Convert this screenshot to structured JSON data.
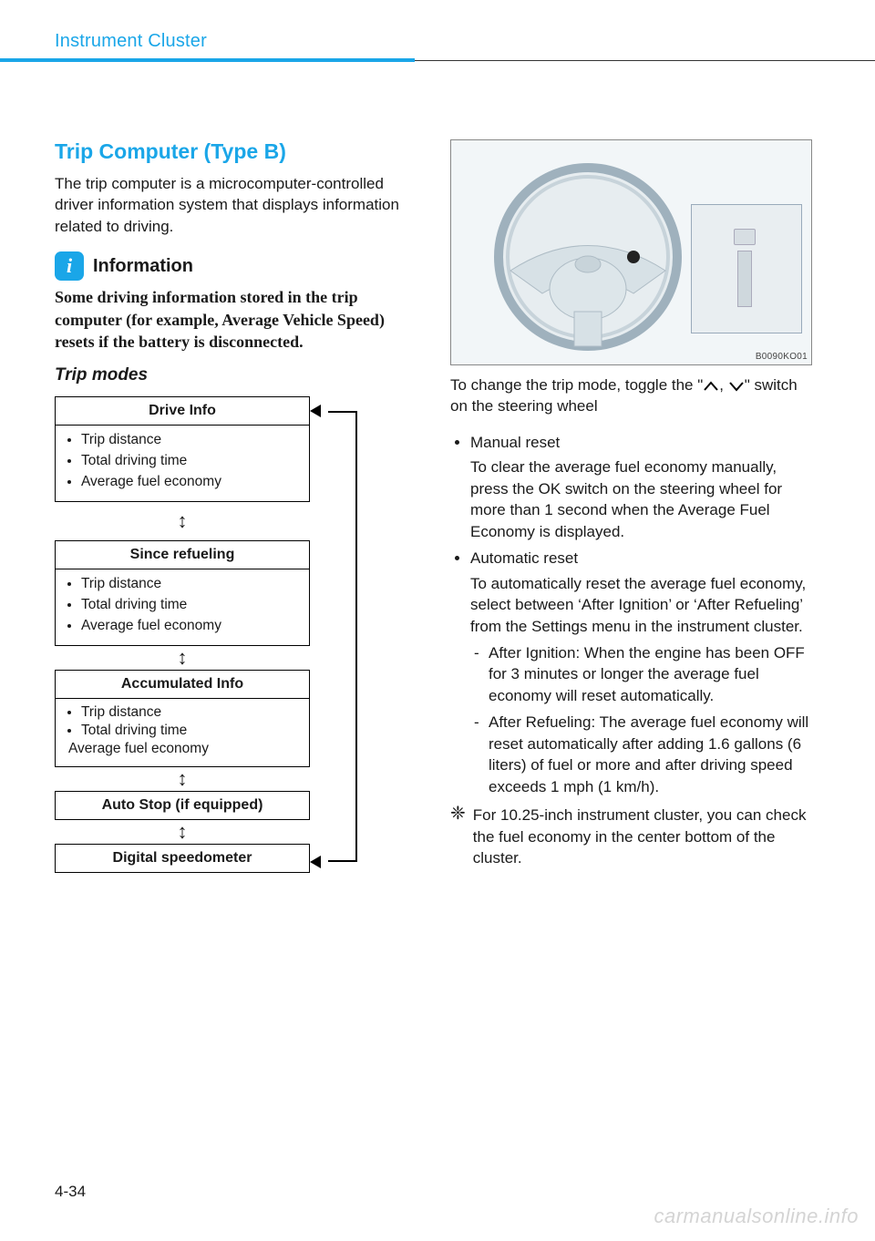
{
  "header": {
    "running": "Instrument Cluster"
  },
  "left": {
    "title": "Trip Computer (Type B)",
    "intro": "The trip computer is a microcomputer-controlled driver information system that displays information related to driving.",
    "info_label": "Information",
    "info_body": "Some driving information stored in the trip computer (for example, Average Vehicle Speed) resets if the battery is disconnected.",
    "sub": "Trip modes",
    "boxes": {
      "drive": {
        "title": "Drive Info",
        "items": [
          "Trip distance",
          "Total driving time",
          "Average fuel economy"
        ]
      },
      "refuel": {
        "title": "Since refueling",
        "items": [
          "Trip distance",
          "Total driving time",
          "Average fuel economy"
        ]
      },
      "accum": {
        "title": "Accumulated Info",
        "items": [
          "Trip distance",
          "Total driving time",
          "Average fuel economy"
        ]
      },
      "autostop": {
        "title": "Auto Stop (if equipped)"
      },
      "speedo": {
        "title": "Digital speedometer"
      }
    }
  },
  "right": {
    "fig_code": "B0090KO01",
    "lead_a": "To change the trip mode, toggle the \"",
    "lead_b": ", ",
    "lead_c": "\" switch on the steering wheel",
    "bullets": {
      "manual": {
        "label": "Manual reset",
        "body": "To clear the average fuel economy manually, press the OK switch on the steering wheel for more than 1 second when the Average Fuel Economy is displayed."
      },
      "auto": {
        "label": "Automatic reset",
        "body": "To automatically reset the average fuel economy, select between ‘After Ignition’ or ‘After Refueling’ from the Settings menu in the instrument cluster.",
        "sub1": "After Ignition: When the engine has been OFF for 3 minutes or longer the average fuel economy will reset automatically.",
        "sub2": "After Refueling: The average fuel economy will reset automatically after adding 1.6 gallons (6 liters) of fuel or more and after driving speed exceeds 1 mph (1 km/h)."
      }
    },
    "note": "For 10.25-inch instrument cluster, you can check the fuel economy in the center bottom of the cluster."
  },
  "footer": {
    "page": "4-34",
    "watermark": "carmanualsonline.info"
  },
  "glyphs": {
    "updown": "↕",
    "asterisk": "❈",
    "info_i": "i"
  }
}
